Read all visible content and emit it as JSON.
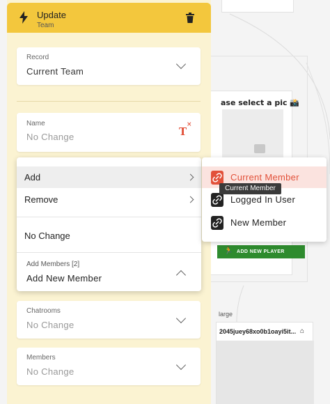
{
  "panel": {
    "title": "Update",
    "subtitle": "Team"
  },
  "fields": {
    "record": {
      "label": "Record",
      "value": "Current Team"
    },
    "name": {
      "label": "Name",
      "value": "No Change"
    },
    "chatrooms": {
      "label": "Chatrooms",
      "value": "No Change"
    },
    "members": {
      "label": "Members",
      "value": "No Change"
    }
  },
  "menu": {
    "items": [
      {
        "label": "Add"
      },
      {
        "label": "Remove"
      }
    ],
    "no_change": "No Change",
    "add_members_label": "Add Members [2]",
    "add_members_value": "Add New Member"
  },
  "submenu": {
    "items": [
      {
        "label": "Current Member"
      },
      {
        "label": "Logged In User"
      },
      {
        "label": "New Member"
      }
    ]
  },
  "tooltip": "Current Member",
  "background": {
    "pic_title": "ase select a pic 📸",
    "add_player": "ADD NEW PLAYER",
    "large_label": "large",
    "id_text": "2045juey68xo0b1oayi5it..."
  },
  "colors": {
    "header": "#f3c73d",
    "panel": "#fbf3d2",
    "accent": "#e2513a",
    "button_green": "#2e8b2e"
  }
}
